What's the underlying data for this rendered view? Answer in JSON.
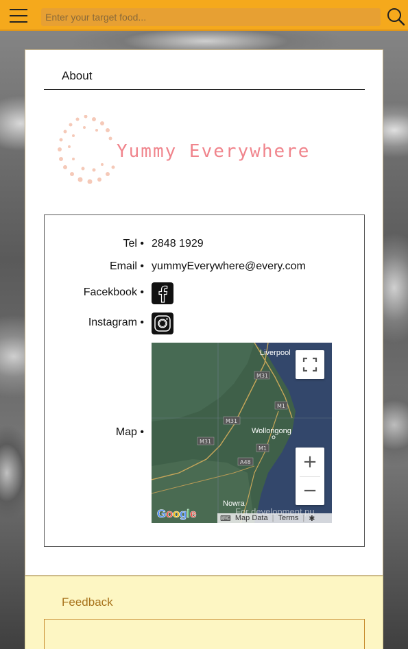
{
  "search": {
    "placeholder": "Enter your target food..."
  },
  "icons": {
    "menu": "hamburger-menu-icon",
    "search": "search-icon",
    "facebook": "facebook-icon",
    "instagram": "instagram-icon"
  },
  "colors": {
    "topbar": "#f5a91c",
    "logo_text": "#f0848c",
    "feedback_bg": "#fdf6c3",
    "feedback_title": "#a8731c"
  },
  "about": {
    "title": "About",
    "logo_text": "Yummy Everywhere",
    "rows": {
      "tel_label": "Tel •",
      "tel_value": "2848 1929",
      "email_label": "Email •",
      "email_value": "yummyEverywhere@every.com",
      "facebook_label": "Facekbook •",
      "instagram_label": "Instagram •",
      "map_label": "Map •"
    }
  },
  "map": {
    "places": [
      "Liverpool",
      "Wollongong",
      "Nowra"
    ],
    "roads": [
      "M31",
      "M31",
      "M31",
      "M1",
      "M1",
      "A48"
    ],
    "watermark": "For development pu",
    "footer": {
      "map_data": "Map Data",
      "terms": "Terms"
    },
    "zoom_in": "+",
    "zoom_out": "−"
  },
  "feedback": {
    "title": "Feedback"
  }
}
